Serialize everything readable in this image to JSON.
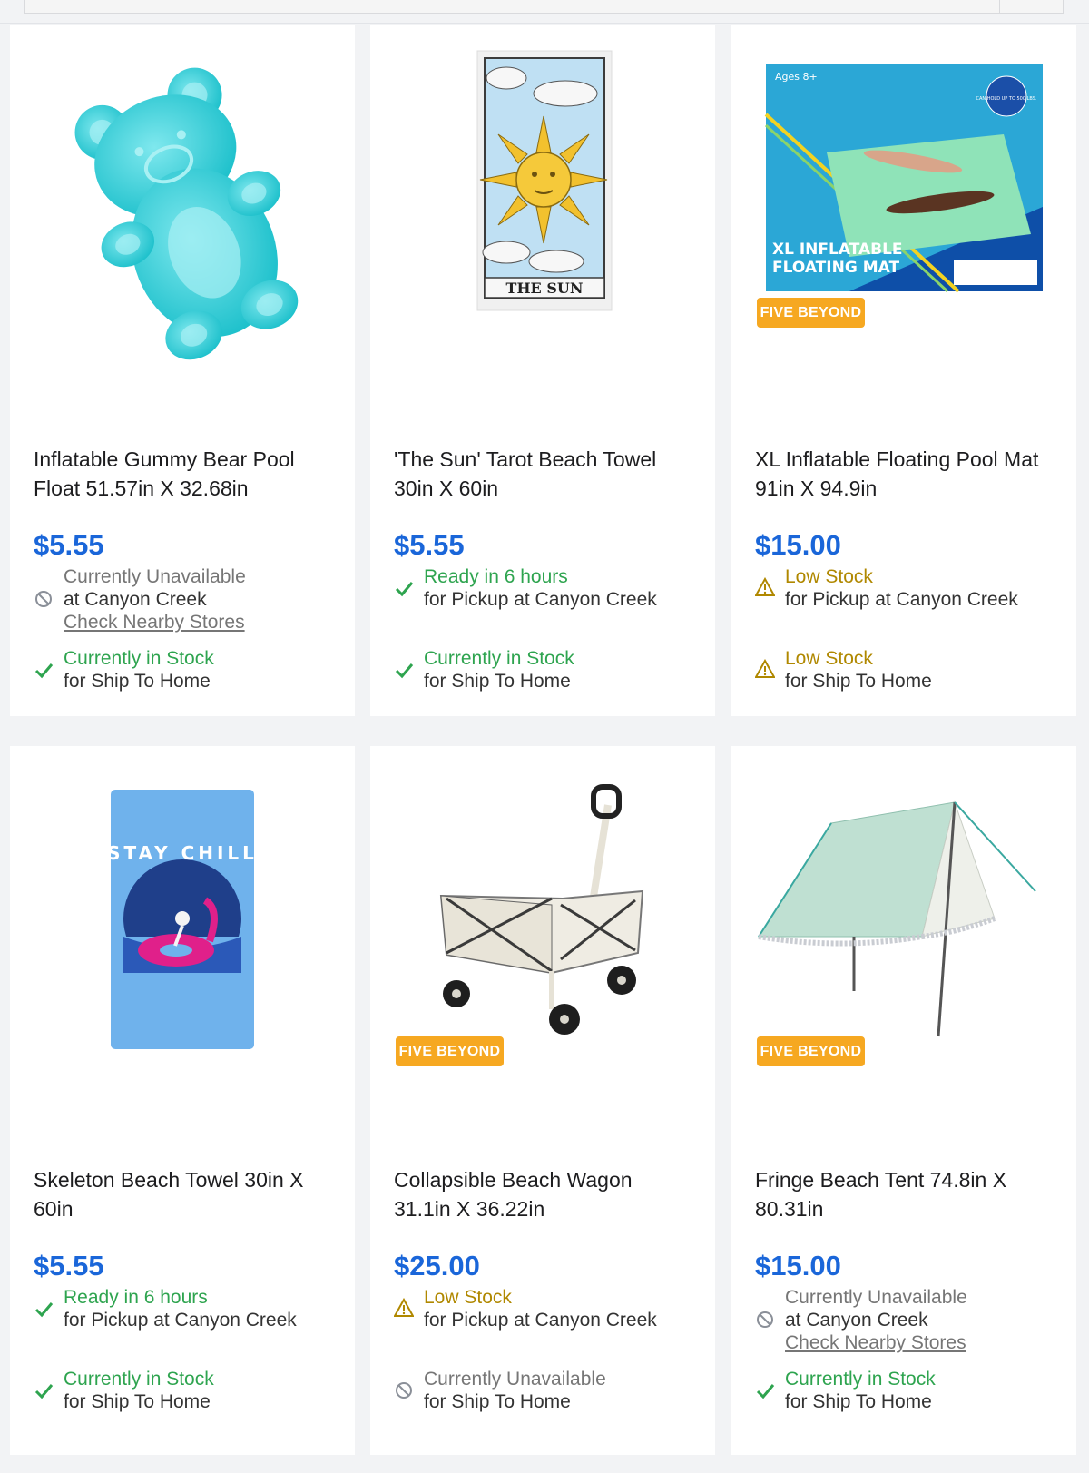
{
  "products": [
    {
      "title": "Inflatable Gummy Bear Pool Float 51.57in X 32.68in",
      "price": "$5.55",
      "pickup": {
        "status": "Currently Unavailable",
        "detail": "at Canyon Creek",
        "link": "Check Nearby Stores",
        "icon": "unavailable-icon"
      },
      "ship": {
        "status": "Currently in Stock",
        "detail": "for Ship To Home",
        "icon": "check-icon"
      }
    },
    {
      "title": "'The Sun' Tarot Beach Towel 30in X 60in",
      "price": "$5.55",
      "pickup": {
        "status": "Ready in 6 hours",
        "detail": "for Pickup at Canyon Creek",
        "icon": "check-icon"
      },
      "ship": {
        "status": "Currently in Stock",
        "detail": "for Ship To Home",
        "icon": "check-icon"
      },
      "image_text": "THE SUN"
    },
    {
      "title": "XL Inflatable Floating Pool Mat 91in X 94.9in",
      "price": "$15.00",
      "badge": "FIVE BEYOND",
      "pickup": {
        "status": "Low Stock",
        "detail": "for Pickup at Canyon Creek",
        "icon": "warning-icon"
      },
      "ship": {
        "status": "Low Stock",
        "detail": "for Ship To Home",
        "icon": "warning-icon"
      },
      "image_text": {
        "age": "Ages 8+",
        "hold": "CAN HOLD UP TO 500 LBS.",
        "name1": "XL INFLATABLE",
        "name2": "FLOATING MAT"
      }
    },
    {
      "title": "Skeleton Beach Towel 30in X 60in",
      "price": "$5.55",
      "pickup": {
        "status": "Ready in 6 hours",
        "detail": "for Pickup at Canyon Creek",
        "icon": "check-icon"
      },
      "ship": {
        "status": "Currently in Stock",
        "detail": "for Ship To Home",
        "icon": "check-icon"
      },
      "image_text": "STAY CHILL"
    },
    {
      "title": "Collapsible Beach Wagon 31.1in X 36.22in",
      "price": "$25.00",
      "badge": "FIVE BEYOND",
      "pickup": {
        "status": "Low Stock",
        "detail": "for Pickup at Canyon Creek",
        "icon": "warning-icon"
      },
      "ship": {
        "status": "Currently Unavailable",
        "detail": "for Ship To Home",
        "icon": "unavailable-icon"
      }
    },
    {
      "title": "Fringe Beach Tent 74.8in X 80.31in",
      "price": "$15.00",
      "badge": "FIVE BEYOND",
      "pickup": {
        "status": "Currently Unavailable",
        "detail": "at Canyon Creek",
        "link": "Check Nearby Stores",
        "icon": "unavailable-icon"
      },
      "ship": {
        "status": "Currently in Stock",
        "detail": "for Ship To Home",
        "icon": "check-icon"
      }
    }
  ],
  "colors": {
    "price": "#1a66d9",
    "in_stock": "#2ea44f",
    "low_stock": "#b08800",
    "unavailable": "#767676",
    "badge": "#f6a821"
  }
}
